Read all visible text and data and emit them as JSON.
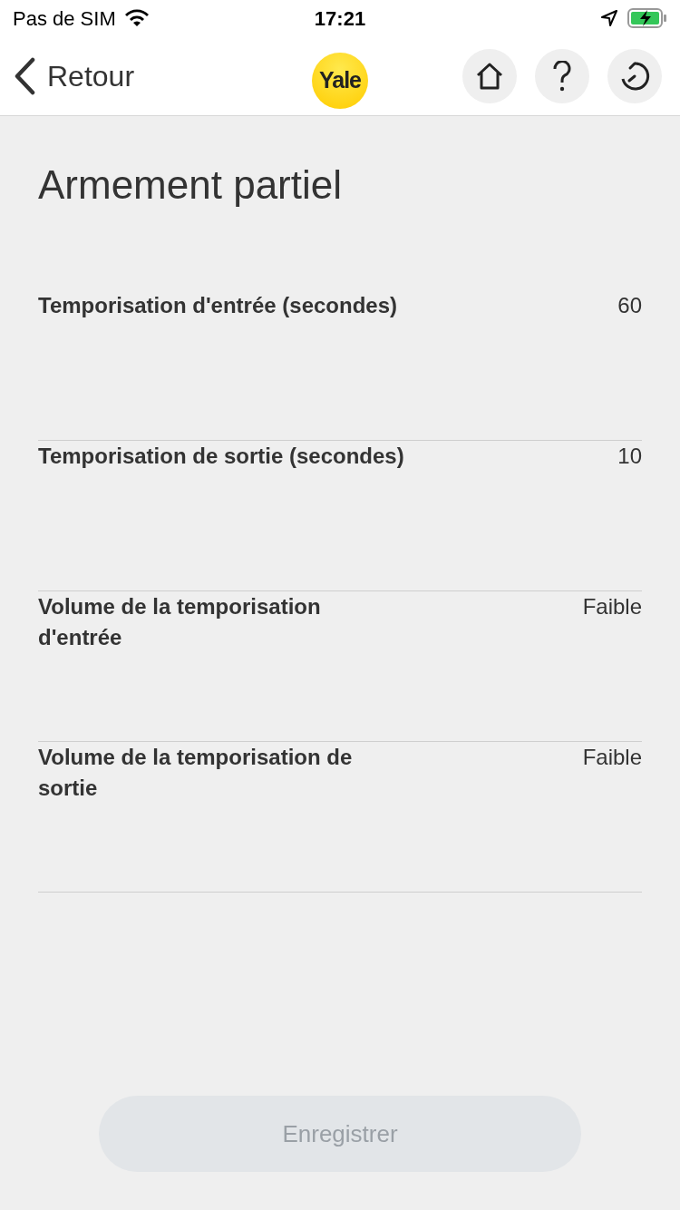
{
  "status_bar": {
    "carrier": "Pas de SIM",
    "time": "17:21"
  },
  "nav_bar": {
    "back_label": "Retour",
    "logo_text": "Yale"
  },
  "title": "Armement partiel",
  "settings": [
    {
      "label": "Temporisation d'entrée (secondes)",
      "value": "60"
    },
    {
      "label": "Temporisation de sortie (secondes)",
      "value": "10"
    },
    {
      "label": "Volume de la temporisation d'entrée",
      "value": "Faible"
    },
    {
      "label": "Volume de la temporisation de sortie",
      "value": "Faible"
    }
  ],
  "save_button": {
    "label": "Enregistrer",
    "disabled": true
  }
}
